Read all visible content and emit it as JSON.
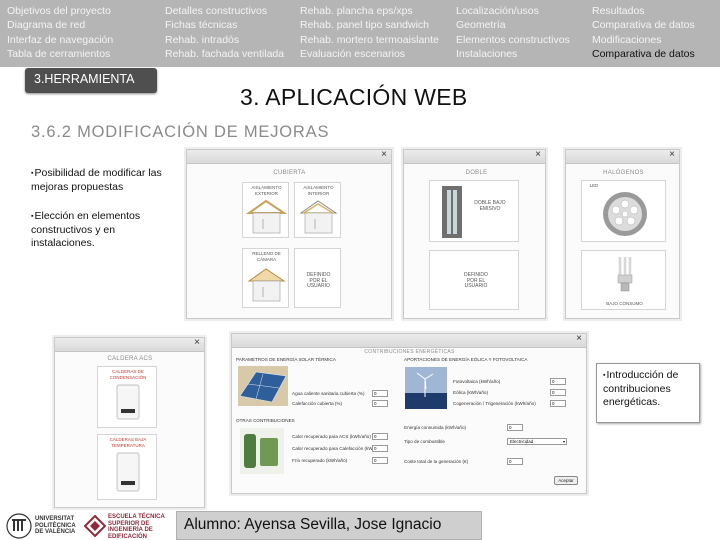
{
  "nav": {
    "col1": [
      "Objetivos del proyecto",
      "Diagrama de red",
      "Interfaz de navegación",
      "Tabla de cerramientos"
    ],
    "col2": [
      "Detalles constructivos",
      "Fichas técnicas",
      "Rehab. intradós",
      "Rehab. fachada ventilada"
    ],
    "col3": [
      "Rehab. plancha eps/xps",
      "Rehab. panel tipo sandwich",
      "Rehab. mortero termoaislante",
      "Evaluación escenarios"
    ],
    "col4": [
      "Localización/usos",
      "Geometría",
      "Elementos constructivos",
      "Instalaciones"
    ],
    "col5": [
      "Resultados",
      "Comparativa de datos",
      "Modificaciones",
      "Comparativa de datos"
    ]
  },
  "tool_tab": "3.HERRAMIENTA",
  "app_title": "3. APLICACIÓN WEB",
  "section_title": "3.6.2 MODIFICACIÓN DE MEJORAS",
  "bullets": {
    "b1": "Posibilidad de modificar las mejoras propuestas",
    "b2": "Elección en elementos constructivos y en instalaciones.",
    "b3": "Introducción de contribuciones energéticas."
  },
  "bullet_mark": "▪",
  "close_glyph": "×",
  "win_cubierta": {
    "title": "CUBIERTA",
    "opt1": "AISLAMIENTO EXTERIOR",
    "opt2": "AISLAMIENTO INTERIOR",
    "opt3": "RELLENO DE CÁMARA",
    "opt4": "DEFINIDO POR EL USUARIO"
  },
  "win_doble": {
    "title": "DOBLE",
    "opt1": "DOBLE BAJO EMISIVO",
    "opt2": "DEFINIDO POR EL USUARIO"
  },
  "win_halogenos": {
    "title": "HALÓGENOS",
    "opt1": "LED",
    "opt2": "BAJO CONSUMO"
  },
  "win_caldera": {
    "title": "CALDERA ACS",
    "opt1": "CALDERAS DE CONDENSACIÓN",
    "opt2": "CALDERAS BAJA TEMPERATURA"
  },
  "win_energia": {
    "title": "CONTRIBUCIONES ENERGÉTICAS",
    "solar_title": "PARAMETROS DE ENERGÍA SOLAR TÉRMICA",
    "eolic_title": "APORTACIONES DE ENERGÍA EÓLICA Y FOTOVOLTAICA",
    "others_title": "OTRAS CONTRIBUCIONES",
    "solar_fields": [
      {
        "label": "Agua caliente sanitaria cubierta (%)",
        "value": "0"
      },
      {
        "label": "Calefacción cubierta (%)",
        "value": "0"
      }
    ],
    "eolic_fields": [
      {
        "label": "Fotovoltaica (kWh/año)",
        "value": "0"
      },
      {
        "label": "Eólica (kWh/año)",
        "value": "0"
      },
      {
        "label": "Cogeneración / Trigeneración (kWh/año)",
        "value": "0"
      }
    ],
    "other_fields": [
      {
        "label": "Calor recuperado para ACS (kWh/año)",
        "value": "0"
      },
      {
        "label": "Calor recuperado para Calefacción (kWh/año)",
        "value": "0"
      },
      {
        "label": "Frío recuperado (kWh/año)",
        "value": "0"
      }
    ],
    "energy_consumed_label": "Energía consumida (kWh/año)",
    "energy_consumed_value": "0",
    "fuel_label": "Tipo de combustible",
    "fuel_value": "Electricidad",
    "generated_label": "Coste total de la generación (€)",
    "generated_value": "0",
    "accept_label": "Aceptar"
  },
  "footer": {
    "author": "Alumno: Ayensa Sevilla, Jose Ignacio",
    "upv_logo_text": "UNIVERSITAT POLITÈCNICA DE VALÈNCIA",
    "ie_logo_text": "ESCUELA TÉCNICA SUPERIOR DE INGENIERÍA DE EDIFICACIÓN"
  },
  "colors": {
    "nav_bg": "#b5b5b5",
    "tab_bg": "#4f4f4f",
    "accent_red": "#c0392b",
    "ie_logo": "#8e2a3a"
  }
}
